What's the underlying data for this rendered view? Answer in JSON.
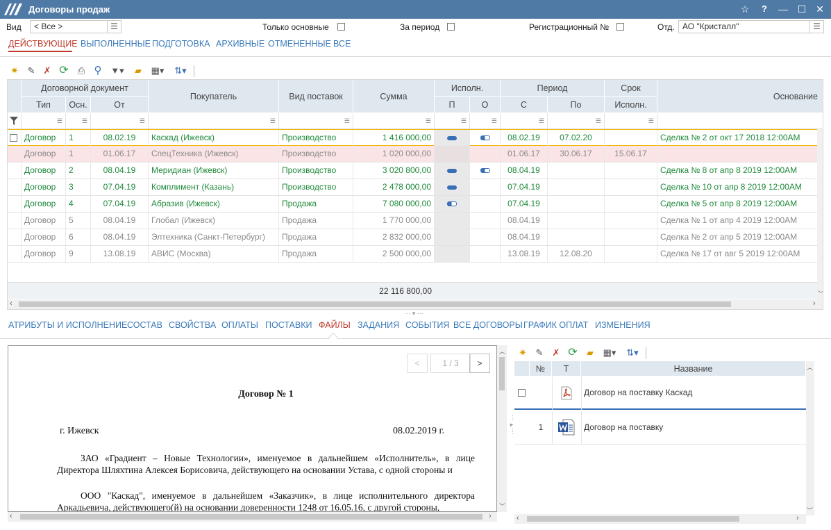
{
  "window": {
    "title": "Договоры продаж",
    "star": "☆",
    "help": "?",
    "minimize": "—",
    "maximize": "☐",
    "close": "✕"
  },
  "filters": {
    "view_label": "Вид",
    "view_value": "< Все >",
    "only_main_label": "Только основные",
    "period_label": "За период",
    "reg_label": "Регистрационный №",
    "dept_label": "Отд.",
    "dept_value": "АО \"Кристалл\""
  },
  "top_tabs": [
    "ДЕЙСТВУЮЩИЕ",
    "ВЫПОЛНЕННЫЕ",
    "ПОДГОТОВКА",
    "АРХИВНЫЕ",
    "ОТМЕНЕННЫЕ",
    "ВСЕ"
  ],
  "grid": {
    "group_headers": {
      "doc": "Договорной документ",
      "exec": "Исполн.",
      "period": "Период",
      "term": "Срок"
    },
    "headers": {
      "type": "Тип",
      "main": "Осн.",
      "from": "От",
      "buyer": "Покупатель",
      "supply": "Вид поставок",
      "sum": "Сумма",
      "p": "П",
      "o": "О",
      "s": "С",
      "po": "По",
      "exec": "Исполн.",
      "basis": "Основание"
    },
    "rows": [
      {
        "type": "Договор",
        "main": "1",
        "from": "08.02.19",
        "buyer": "Каскад (Ижевск)",
        "supply": "Производство",
        "sum": "1 416 000,00",
        "s": "08.02.19",
        "po": "07.02.20",
        "exec": "",
        "basis": "Сделка № 2 от окт 17 2018 12:00AM"
      },
      {
        "type": "Договор",
        "main": "1",
        "from": "01.06.17",
        "buyer": "СпецТехника (Ижевск)",
        "supply": "Производство",
        "sum": "1 020 000,00",
        "s": "01.06.17",
        "po": "30.06.17",
        "exec": "15.06.17",
        "basis": ""
      },
      {
        "type": "Договор",
        "main": "2",
        "from": "08.04.19",
        "buyer": "Меридиан (Ижевск)",
        "supply": "Производство",
        "sum": "3 020 800,00",
        "s": "08.04.19",
        "po": "",
        "exec": "",
        "basis": "Сделка № 8 от апр  8 2019 12:00AM"
      },
      {
        "type": "Договор",
        "main": "3",
        "from": "07.04.19",
        "buyer": "Комплимент (Казань)",
        "supply": "Производство",
        "sum": "2 478 000,00",
        "s": "07.04.19",
        "po": "",
        "exec": "",
        "basis": "Сделка № 10 от апр  8 2019 12:00AM"
      },
      {
        "type": "Договор",
        "main": "4",
        "from": "07.04.19",
        "buyer": "Абразив (Ижевск)",
        "supply": "Продажа",
        "sum": "7 080 000,00",
        "s": "07.04.19",
        "po": "",
        "exec": "",
        "basis": "Сделка № 5 от апр  8 2019 12:00AM"
      },
      {
        "type": "Договор",
        "main": "5",
        "from": "08.04.19",
        "buyer": "Глобал (Ижевск)",
        "supply": "Продажа",
        "sum": "1 770 000,00",
        "s": "08.04.19",
        "po": "",
        "exec": "",
        "basis": "Сделка № 1 от апр  4 2019 12:00AM"
      },
      {
        "type": "Договор",
        "main": "6",
        "from": "08.04.19",
        "buyer": "Элтехника (Санкт-Петербург)",
        "supply": "Продажа",
        "sum": "2 832 000,00",
        "s": "08.04.19",
        "po": "",
        "exec": "",
        "basis": "Сделка № 2 от апр  5 2019 12:00AM"
      },
      {
        "type": "Договор",
        "main": "9",
        "from": "13.08.19",
        "buyer": "АВИС (Москва)",
        "supply": "Продажа",
        "sum": "2 500 000,00",
        "s": "13.08.19",
        "po": "12.08.20",
        "exec": "",
        "basis": "Сделка № 17 от авг  5 2019 12:00AM"
      }
    ],
    "total": "22 116 800,00"
  },
  "bottom_tabs": [
    "АТРИБУТЫ И ИСПОЛНЕНИЕ",
    "СОСТАВ",
    "СВОЙСТВА",
    "ОПЛАТЫ",
    "ПОСТАВКИ",
    "ФАЙЛЫ",
    "ЗАДАНИЯ",
    "СОБЫТИЯ",
    "ВСЕ ДОГОВОРЫ",
    "ГРАФИК ОПЛАТ",
    "ИЗМЕНЕНИЯ"
  ],
  "doc": {
    "page": "1 / 3",
    "prev": "<",
    "next": ">",
    "title": "Договор № 1",
    "city": "г. Ижевск",
    "date": "08.02.2019 г.",
    "p1": "ЗАО «Градиент – Новые Технологии», именуемое в дальнейшем «Исполнитель», в лице Директора Шляхтина Алексея Борисовича, действующего на основании Устава, с одной стороны и",
    "p2": "ООО \"Каскад\", именуемое в дальнейшем «Заказчик», в лице исполнительного директора Аркадьевича, действующего(й) на основании доверенности 1248 от 16.05.16, с другой стороны,"
  },
  "files": {
    "headers": {
      "num": "№",
      "t": "Т",
      "name": "Название"
    },
    "rows": [
      {
        "num": "",
        "icon": "pdf-icon",
        "name": "Договор на поставку Каскад"
      },
      {
        "num": "1",
        "icon": "word-icon",
        "name": "Договор на поставку"
      }
    ]
  },
  "colors": {
    "accent": "#3a7ab8",
    "titlebar": "#4f7aa6",
    "active_tab": "#c0392b",
    "green": "#1f8a3b",
    "selected_row": "#fbe4e6",
    "focus": "#f0b400"
  }
}
